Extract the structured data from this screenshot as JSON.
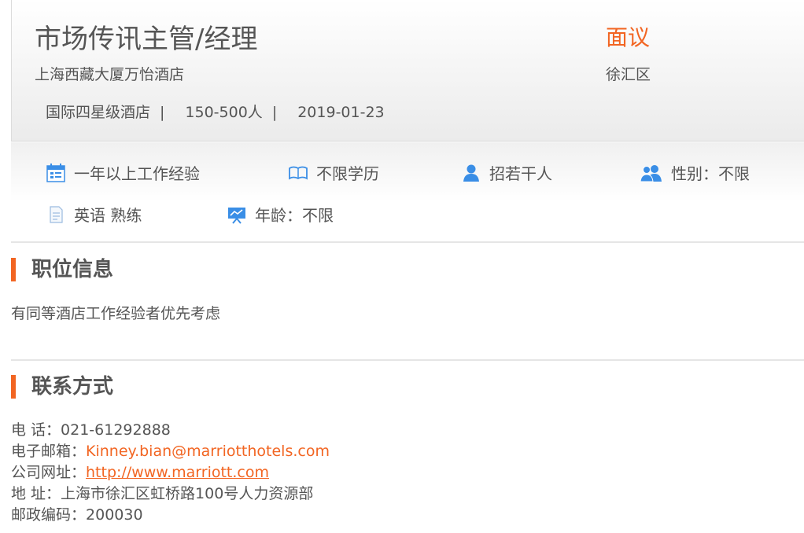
{
  "job": {
    "title": "市场传讯主管/经理",
    "salary": "面议",
    "company": "上海西藏大厦万怡酒店",
    "district": "徐汇区",
    "meta": {
      "type": "国际四星级酒店",
      "size": "150-500人",
      "date": "2019-01-23",
      "separator": "|"
    }
  },
  "requirements": [
    {
      "icon": "calendar-icon",
      "label": "一年以上工作经验"
    },
    {
      "icon": "book-icon",
      "label": "不限学历"
    },
    {
      "icon": "person-icon",
      "label": "招若干人"
    },
    {
      "icon": "people-icon",
      "label": "性别：不限"
    },
    {
      "icon": "document-icon",
      "label": "英语 熟练"
    },
    {
      "icon": "presentation-icon",
      "label": "年龄：不限"
    }
  ],
  "position_section": {
    "title": "职位信息",
    "description": "有同等酒店工作经验者优先考虑"
  },
  "contact_section": {
    "title": "联系方式",
    "phone_label": "电 话：",
    "phone": "021-61292888",
    "email_label": "电子邮箱：",
    "email": "Kinney.bian@marriotthotels.com",
    "website_label": "公司网址：",
    "website": "http://www.marriott.com",
    "address_label": "地 址：",
    "address": "上海市徐汇区虹桥路100号人力资源部",
    "postcode_label": "邮政编码：",
    "postcode": "200030"
  },
  "colors": {
    "accent": "#f26522",
    "icon_blue": "#3a8ee6",
    "text": "#555555"
  }
}
